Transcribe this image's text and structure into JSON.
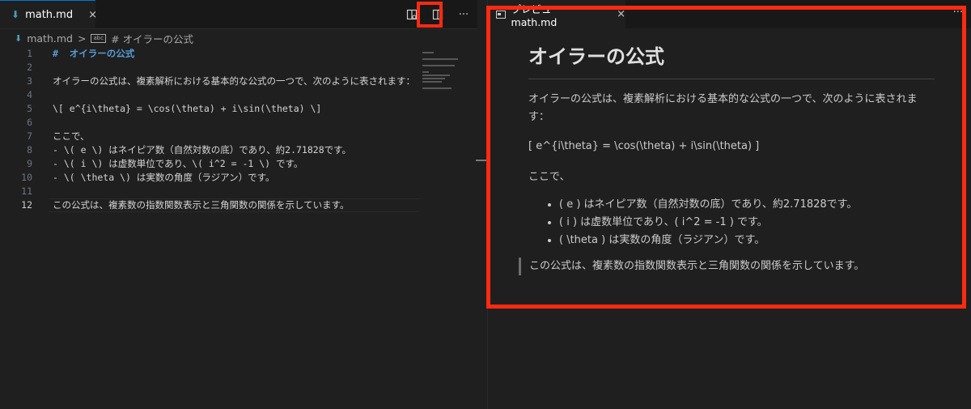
{
  "editor": {
    "tab": {
      "label": "math.md",
      "close": "×"
    },
    "actions": {
      "preview_icon": "open-preview-to-side-icon",
      "split_icon": "split-editor-icon",
      "more": "···"
    },
    "breadcrumb": {
      "file": "math.md",
      "sep": ">",
      "tag": "abc",
      "section": "# オイラーの公式"
    },
    "lines": [
      {
        "n": "1",
        "text": "オイラーの公式",
        "heading": true
      },
      {
        "n": "2",
        "text": ""
      },
      {
        "n": "3",
        "text": "オイラーの公式は、複素解析における基本的な公式の一つで、次のように表されます："
      },
      {
        "n": "4",
        "text": ""
      },
      {
        "n": "5",
        "text": "\\[ e^{i\\theta} = \\cos(\\theta) + i\\sin(\\theta) \\]"
      },
      {
        "n": "6",
        "text": ""
      },
      {
        "n": "7",
        "text": "ここで、"
      },
      {
        "n": "8",
        "text": "- \\( e \\) はネイピア数（自然対数の底）であり、約2.71828です。"
      },
      {
        "n": "9",
        "text": "- \\( i \\) は虚数単位であり、\\( i^2 = -1 \\) です。"
      },
      {
        "n": "10",
        "text": "- \\( \\theta \\) は実数の角度（ラジアン）です。"
      },
      {
        "n": "11",
        "text": ""
      },
      {
        "n": "12",
        "text": "この公式は、複素数の指数関数表示と三角関数の関係を示しています。"
      }
    ]
  },
  "preview": {
    "tab": {
      "label": "プレビュー math.md",
      "close": "×"
    },
    "more": "···",
    "h1": "オイラーの公式",
    "para1": "オイラーの公式は、複素解析における基本的な公式の一つで、次のように表されます：",
    "formula": "[ e^{i\\theta} = \\cos(\\theta) + i\\sin(\\theta) ]",
    "koko": "ここで、",
    "list": [
      "( e ) はネイピア数（自然対数の底）であり、約2.71828です。",
      "( i ) は虚数単位であり、( i^2 = -1 ) です。",
      "( \\theta ) は実数の角度（ラジアン）です。"
    ],
    "quote": "この公式は、複素数の指数関数表示と三角関数の関係を示しています。"
  },
  "colors": {
    "highlight": "#ff2a12",
    "heading": "#569cd6",
    "background": "#1f1f1f"
  }
}
